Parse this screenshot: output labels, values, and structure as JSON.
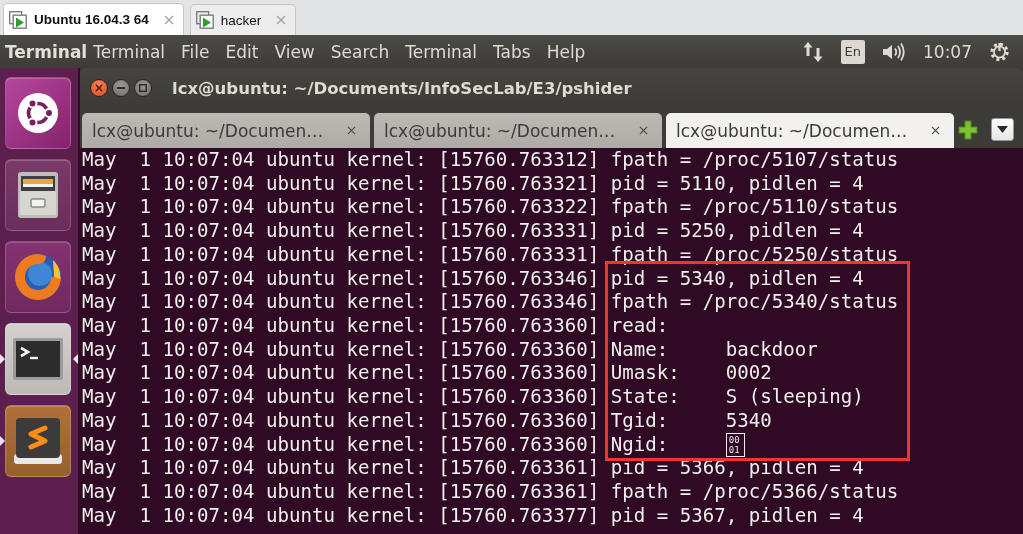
{
  "vm_tabs": [
    {
      "label": "Ubuntu 16.04.3 64",
      "selected": true
    },
    {
      "label": "hacker",
      "selected": false
    }
  ],
  "top_panel": {
    "app_title": "Terminal",
    "menu": [
      "Terminal",
      "File",
      "Edit",
      "View",
      "Search",
      "Terminal",
      "Tabs",
      "Help"
    ],
    "keyboard_layout": "En",
    "clock": "10:07"
  },
  "launcher": {
    "items": [
      {
        "kind": "dash",
        "running": false,
        "focused": false
      },
      {
        "kind": "files",
        "running": false,
        "focused": false
      },
      {
        "kind": "browser",
        "running": false,
        "focused": false
      },
      {
        "kind": "terminal",
        "running": true,
        "focused": true
      },
      {
        "kind": "editor",
        "running": true,
        "focused": false
      }
    ]
  },
  "window": {
    "title": "lcx@ubuntu: ~/Documents/InfoSecLab/E3/pshider",
    "tabs": [
      {
        "label": "lcx@ubuntu: ~/Documen…",
        "selected": false
      },
      {
        "label": "lcx@ubuntu: ~/Documen…",
        "selected": false
      },
      {
        "label": "lcx@ubuntu: ~/Documen…",
        "selected": true
      }
    ]
  },
  "terminal": {
    "blocks": [
      {
        "highlighted": false,
        "lines": [
          {
            "text": "May  1 10:07:04 ubuntu kernel: [15760.763312] fpath = /proc/5107/status"
          },
          {
            "text": "May  1 10:07:04 ubuntu kernel: [15760.763321] pid = 5110, pidlen = 4"
          },
          {
            "text": "May  1 10:07:04 ubuntu kernel: [15760.763322] fpath = /proc/5110/status"
          },
          {
            "text": "May  1 10:07:04 ubuntu kernel: [15760.763331] pid = 5250, pidlen = 4"
          },
          {
            "text": "May  1 10:07:04 ubuntu kernel: [15760.763331] fpath = /proc/5250/status"
          }
        ]
      },
      {
        "highlighted": true,
        "lines": [
          {
            "text": "May  1 10:07:04 ubuntu kernel: [15760.763346] pid = 5340, pidlen = 4"
          },
          {
            "text": "May  1 10:07:04 ubuntu kernel: [15760.763346] fpath = /proc/5340/status"
          },
          {
            "text": "May  1 10:07:04 ubuntu kernel: [15760.763360] read:"
          },
          {
            "text": "May  1 10:07:04 ubuntu kernel: [15760.763360] Name:     backdoor"
          },
          {
            "text": "May  1 10:07:04 ubuntu kernel: [15760.763360] Umask:    0002"
          },
          {
            "text": "May  1 10:07:04 ubuntu kernel: [15760.763360] State:    S (sleeping)"
          },
          {
            "text": "May  1 10:07:04 ubuntu kernel: [15760.763360] Tgid:     5340"
          },
          {
            "text": "May  1 10:07:04 ubuntu kernel: [15760.763360] Ngid:",
            "glyph": "00 01"
          }
        ]
      },
      {
        "highlighted": false,
        "lines": [
          {
            "text": "May  1 10:07:04 ubuntu kernel: [15760.763361] pid = 5366, pidlen = 4"
          },
          {
            "text": "May  1 10:07:04 ubuntu kernel: [15760.763361] fpath = /proc/5366/status"
          },
          {
            "text": "May  1 10:07:04 ubuntu kernel: [15760.763377] pid = 5367, pidlen = 4"
          }
        ]
      }
    ]
  }
}
